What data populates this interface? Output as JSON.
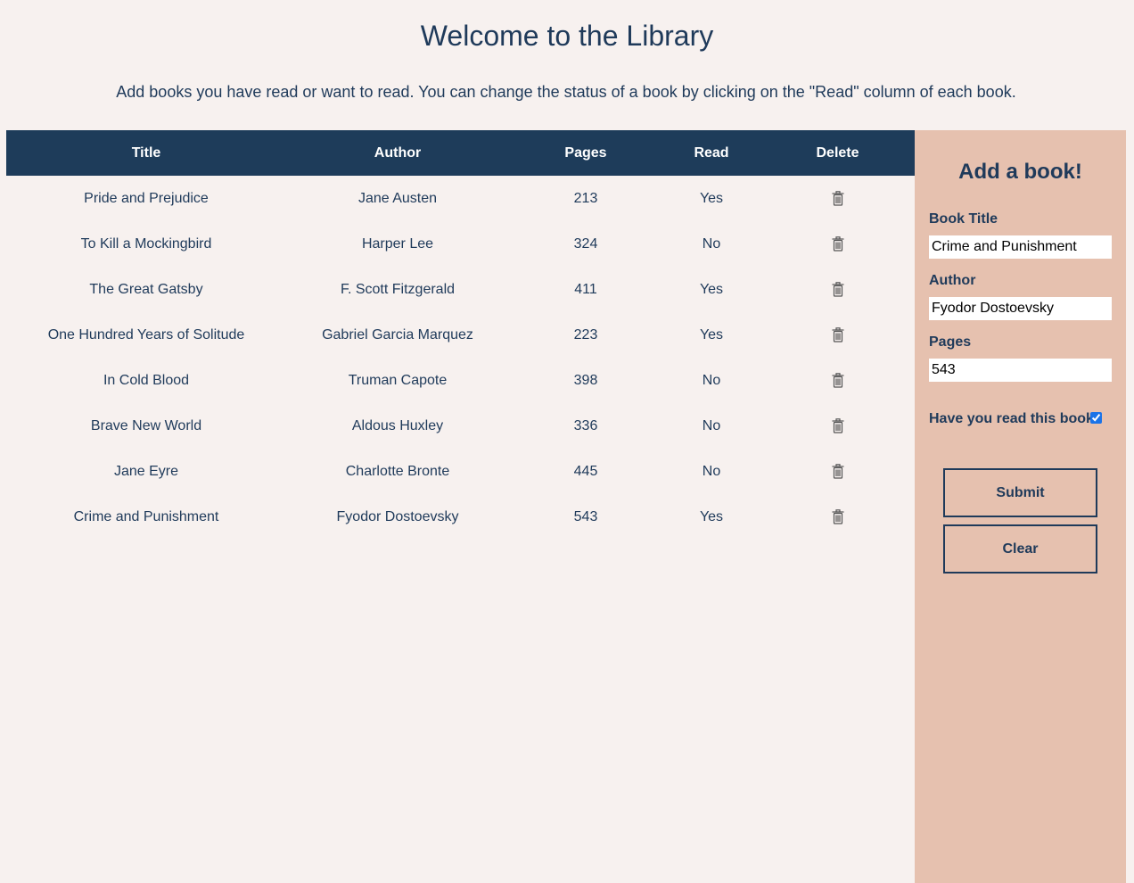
{
  "header": {
    "title": "Welcome to the Library",
    "intro": "Add books you have read or want to read. You can change the status of a book by clicking on the \"Read\" column of each book."
  },
  "table": {
    "columns": [
      "Title",
      "Author",
      "Pages",
      "Read",
      "Delete"
    ],
    "rows": [
      {
        "title": "Pride and Prejudice",
        "author": "Jane Austen",
        "pages": "213",
        "read": "Yes"
      },
      {
        "title": "To Kill a Mockingbird",
        "author": "Harper Lee",
        "pages": "324",
        "read": "No"
      },
      {
        "title": "The Great Gatsby",
        "author": "F. Scott Fitzgerald",
        "pages": "411",
        "read": "Yes"
      },
      {
        "title": "One Hundred Years of Solitude",
        "author": "Gabriel Garcia Marquez",
        "pages": "223",
        "read": "Yes"
      },
      {
        "title": "In Cold Blood",
        "author": "Truman Capote",
        "pages": "398",
        "read": "No"
      },
      {
        "title": "Brave New World",
        "author": "Aldous Huxley",
        "pages": "336",
        "read": "No"
      },
      {
        "title": "Jane Eyre",
        "author": "Charlotte Bronte",
        "pages": "445",
        "read": "No"
      },
      {
        "title": "Crime and Punishment",
        "author": "Fyodor Dostoevsky",
        "pages": "543",
        "read": "Yes"
      }
    ],
    "delete_icon": "trash-icon"
  },
  "form": {
    "title": "Add a book!",
    "book_title_label": "Book Title",
    "book_title_value": "Crime and Punishment",
    "author_label": "Author",
    "author_value": "Fyodor Dostoevsky",
    "pages_label": "Pages",
    "pages_value": "543",
    "read_question": "Have you read this book?",
    "read_checked": true,
    "submit_label": "Submit",
    "clear_label": "Clear"
  },
  "colors": {
    "background": "#f7f1ef",
    "header_row": "#1e3c5a",
    "text": "#1f3a5a",
    "side_panel": "#e6c1af"
  }
}
